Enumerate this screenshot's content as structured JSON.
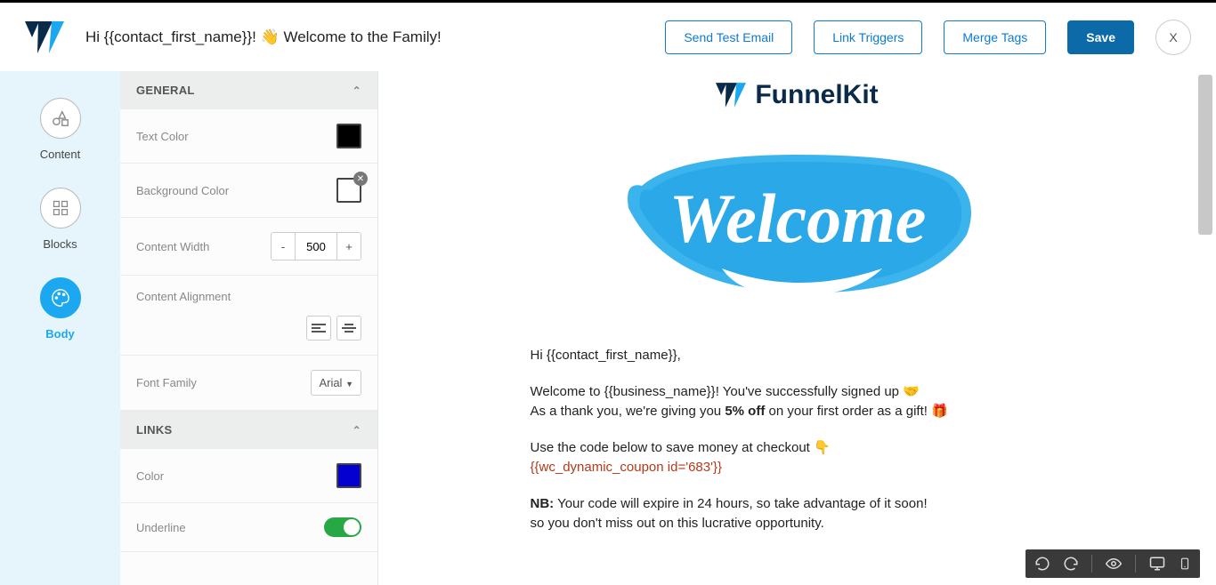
{
  "header": {
    "subject": "Hi {{contact_first_name}}! 👋 Welcome to the Family!",
    "send_test": "Send Test Email",
    "link_triggers": "Link Triggers",
    "merge_tags": "Merge Tags",
    "save": "Save",
    "close": "X"
  },
  "rail": {
    "content": "Content",
    "blocks": "Blocks",
    "body": "Body"
  },
  "panel": {
    "general": {
      "title": "GENERAL",
      "text_color": "Text Color",
      "bg_color": "Background Color",
      "content_width": "Content Width",
      "width_val": "500",
      "content_align": "Content Alignment",
      "font_family": "Font Family",
      "font_val": "Arial"
    },
    "links": {
      "title": "LINKS",
      "color": "Color",
      "underline": "Underline"
    }
  },
  "email": {
    "brand": "FunnelKit",
    "greeting": "Hi {{contact_first_name}},",
    "p1a": "Welcome to {{business_name}}! You've successfully signed up 🤝",
    "p1b": "As a thank you, we're giving you ",
    "p1c": "5% off",
    "p1d": " on your first order as a gift! ",
    "gift": "🎁",
    "p2": "Use the code below to save money at checkout 👇",
    "coupon": "{{wc_dynamic_coupon id='683'}}",
    "nb": "NB:",
    "p3a": " Your code will expire in 24 hours, so take advantage of it soon!",
    "p3b": "so you don't miss out on this lucrative opportunity."
  },
  "colors": {
    "text": "#000000",
    "bg": "#ffffff",
    "link": "#0400d0"
  }
}
